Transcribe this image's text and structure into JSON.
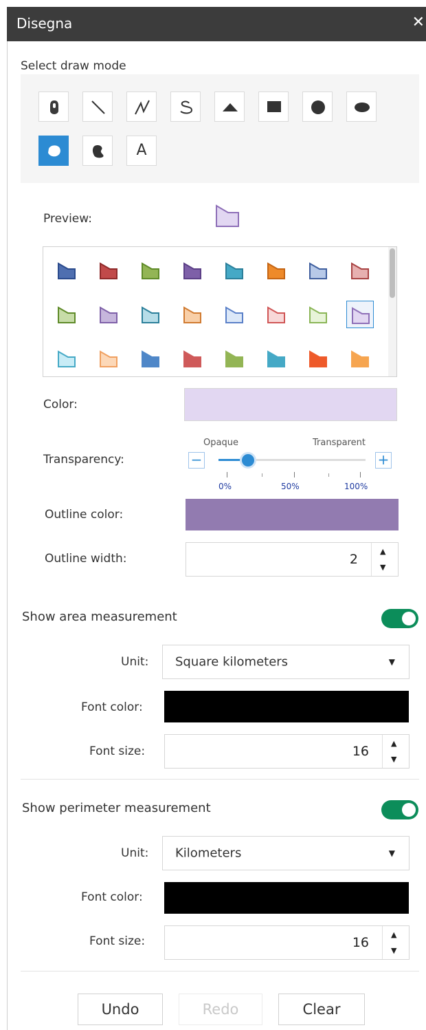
{
  "window": {
    "title": "Disegna"
  },
  "draw_mode": {
    "label": "Select draw mode",
    "tools": [
      {
        "icon": "point-icon"
      },
      {
        "icon": "line-icon"
      },
      {
        "icon": "polyline-icon"
      },
      {
        "icon": "freehand-line-icon"
      },
      {
        "icon": "triangle-icon"
      },
      {
        "icon": "rectangle-icon"
      },
      {
        "icon": "circle-icon"
      },
      {
        "icon": "ellipse-icon"
      },
      {
        "icon": "polygon-icon",
        "active": true
      },
      {
        "icon": "freehand-polygon-icon"
      },
      {
        "icon": "text-icon",
        "glyph": "A"
      }
    ]
  },
  "symbol": {
    "preview_label": "Preview:",
    "palette": [
      {
        "fill": "#4f6fb0",
        "stroke": "#2a4a8c"
      },
      {
        "fill": "#c14a4a",
        "stroke": "#8e2a2a"
      },
      {
        "fill": "#93b555",
        "stroke": "#5e8a28"
      },
      {
        "fill": "#7e60a8",
        "stroke": "#5b3f86"
      },
      {
        "fill": "#45a9c6",
        "stroke": "#2b7f9a"
      },
      {
        "fill": "#ee8a2a",
        "stroke": "#c46514"
      },
      {
        "fill": "#b7c9e8",
        "stroke": "#3e5e9e"
      },
      {
        "fill": "#e7b0b0",
        "stroke": "#a84242"
      },
      {
        "fill": "#c7dca8",
        "stroke": "#5e8a28"
      },
      {
        "fill": "#c6b6dc",
        "stroke": "#7e60a8"
      },
      {
        "fill": "#b6dde8",
        "stroke": "#2b7f9a"
      },
      {
        "fill": "#f8cfa8",
        "stroke": "#d07a30"
      },
      {
        "fill": "#dce8f8",
        "stroke": "#5a80c8"
      },
      {
        "fill": "#f8d8d8",
        "stroke": "#d05656"
      },
      {
        "fill": "#e8f4d8",
        "stroke": "#8ab556"
      },
      {
        "fill": "#e2d7f2",
        "stroke": "#8e6fb8",
        "selected": true
      },
      {
        "fill": "#c8ecf6",
        "stroke": "#45a9c6"
      },
      {
        "fill": "#fcd8b8",
        "stroke": "#f0a060"
      },
      {
        "fill": "#4f87c8",
        "stroke": "#4f87c8"
      },
      {
        "fill": "#cf5a5a",
        "stroke": "#cf5a5a"
      },
      {
        "fill": "#93b555",
        "stroke": "#93b555"
      },
      {
        "fill": "#45a9c6",
        "stroke": "#45a9c6"
      },
      {
        "fill": "#ee5a2a",
        "stroke": "#ee5a2a"
      },
      {
        "fill": "#f6a550",
        "stroke": "#f6a550"
      }
    ],
    "preview": {
      "fill": "#e2d7f2",
      "stroke": "#8e6fb8"
    },
    "color_label": "Color:",
    "color_value": "#e2d7f2",
    "transparency_label": "Transparency:",
    "transparency": {
      "left_label": "Opaque",
      "right_label": "Transparent",
      "minus": "−",
      "plus": "+",
      "ticks": [
        "0%",
        "50%",
        "100%"
      ],
      "value_pct": 20
    },
    "outline_color_label": "Outline color:",
    "outline_color_value": "#927bb0",
    "outline_width_label": "Outline width:",
    "outline_width": "2"
  },
  "area": {
    "toggle_label": "Show area measurement",
    "enabled": true,
    "unit_label": "Unit:",
    "unit": "Square kilometers",
    "font_color_label": "Font color:",
    "font_color": "#000000",
    "font_size_label": "Font size:",
    "font_size": "16"
  },
  "perimeter": {
    "toggle_label": "Show perimeter measurement",
    "enabled": true,
    "unit_label": "Unit:",
    "unit": "Kilometers",
    "font_color_label": "Font color:",
    "font_color": "#000000",
    "font_size_label": "Font size:",
    "font_size": "16"
  },
  "actions": {
    "undo": "Undo",
    "redo": "Redo",
    "clear": "Clear"
  }
}
